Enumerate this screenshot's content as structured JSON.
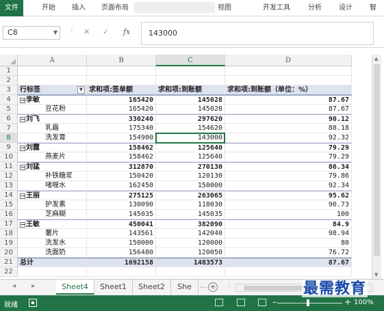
{
  "ribbon": {
    "tabs": [
      "文件",
      "开始",
      "插入",
      "页面布局",
      "视图",
      "开发工具",
      "分析",
      "设计",
      "智"
    ]
  },
  "formula_bar": {
    "name_box": "C8",
    "cancel_symbol": "✕",
    "enter_symbol": "✓",
    "fx_label": "fx",
    "value": "143000"
  },
  "columns": [
    "A",
    "B",
    "C",
    "D"
  ],
  "rows": [
    "1",
    "2",
    "3",
    "4",
    "5",
    "6",
    "7",
    "8",
    "9",
    "10",
    "11",
    "12",
    "13",
    "14",
    "15",
    "16",
    "17",
    "18",
    "19",
    "20",
    "21",
    "22"
  ],
  "pivot": {
    "row_label_header": "行标签",
    "header_b": "求和项:签单额",
    "header_c": "求和项:到账额",
    "header_d": "求和项:到账额（单位：%）",
    "records": [
      {
        "label": "李敏",
        "b": "165420",
        "c": "145028",
        "d": "87.67",
        "group": true
      },
      {
        "label": "豆花粉",
        "b": "165420",
        "c": "145028",
        "d": "87.67",
        "group": false
      },
      {
        "label": "刘飞",
        "b": "330240",
        "c": "297620",
        "d": "90.12",
        "group": true
      },
      {
        "label": "乳霜",
        "b": "175340",
        "c": "154620",
        "d": "88.18",
        "group": false
      },
      {
        "label": "洗发膏",
        "b": "154900",
        "c": "143000",
        "d": "92.32",
        "group": false
      },
      {
        "label": "刘露",
        "b": "158462",
        "c": "125640",
        "d": "79.29",
        "group": true
      },
      {
        "label": "燕麦片",
        "b": "158462",
        "c": "125640",
        "d": "79.29",
        "group": false
      },
      {
        "label": "刘猛",
        "b": "312870",
        "c": "270130",
        "d": "86.34",
        "group": true
      },
      {
        "label": "补铁糖浆",
        "b": "150420",
        "c": "120130",
        "d": "79.86",
        "group": false
      },
      {
        "label": "啫喱水",
        "b": "162450",
        "c": "150000",
        "d": "92.34",
        "group": false
      },
      {
        "label": "王丽",
        "b": "275125",
        "c": "263065",
        "d": "95.62",
        "group": true
      },
      {
        "label": "护发素",
        "b": "130090",
        "c": "118030",
        "d": "90.73",
        "group": false
      },
      {
        "label": "芝麻糊",
        "b": "145035",
        "c": "145035",
        "d": "100",
        "group": false
      },
      {
        "label": "王敏",
        "b": "450041",
        "c": "382090",
        "d": "84.9",
        "group": true
      },
      {
        "label": "薯片",
        "b": "143561",
        "c": "142040",
        "d": "98.94",
        "group": false
      },
      {
        "label": "洗发水",
        "b": "150000",
        "c": "120000",
        "d": "80",
        "group": false
      },
      {
        "label": "洗面奶",
        "b": "156480",
        "c": "120050",
        "d": "76.72",
        "group": false
      }
    ],
    "total": {
      "label": "总计",
      "b": "1692158",
      "c": "1483573",
      "d": "87.67"
    }
  },
  "sheet_tabs": [
    "Sheet4",
    "Sheet1",
    "Sheet2",
    "She"
  ],
  "status": {
    "ready": "就绪",
    "zoom": "100%"
  },
  "watermark": "最需教育",
  "colors": {
    "accent": "#217346",
    "watermark": "#1a4aa8"
  }
}
